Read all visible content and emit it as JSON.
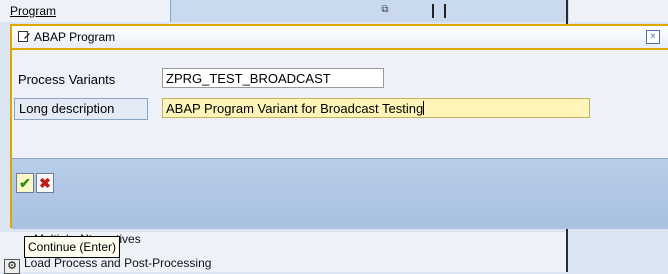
{
  "background": {
    "top_label": "Program",
    "top_icon": "window-restore-icon",
    "row1_text": "n Multiple Alternatives",
    "row1_icon": "tree-node-icon",
    "row2_text": "Load Process and Post-Processing",
    "row2_icon": "gear-icon"
  },
  "dialog": {
    "title": "ABAP Program",
    "title_icon": "program-edit-icon",
    "close_icon": "close-icon",
    "fields": {
      "process_variants_label": "Process Variants",
      "process_variants_value": "ZPRG_TEST_BROADCAST",
      "long_description_label": "Long description",
      "long_description_value": "ABAP Program Variant for Broadcast Testing"
    },
    "buttons": {
      "continue_icon": "checkmark-icon",
      "cancel_icon": "cross-icon"
    },
    "tooltip": "Continue  (Enter)"
  },
  "colors": {
    "accent_border": "#e0a600",
    "button_bar": "#a9c1e2",
    "highlight_field": "#fff5b8"
  }
}
